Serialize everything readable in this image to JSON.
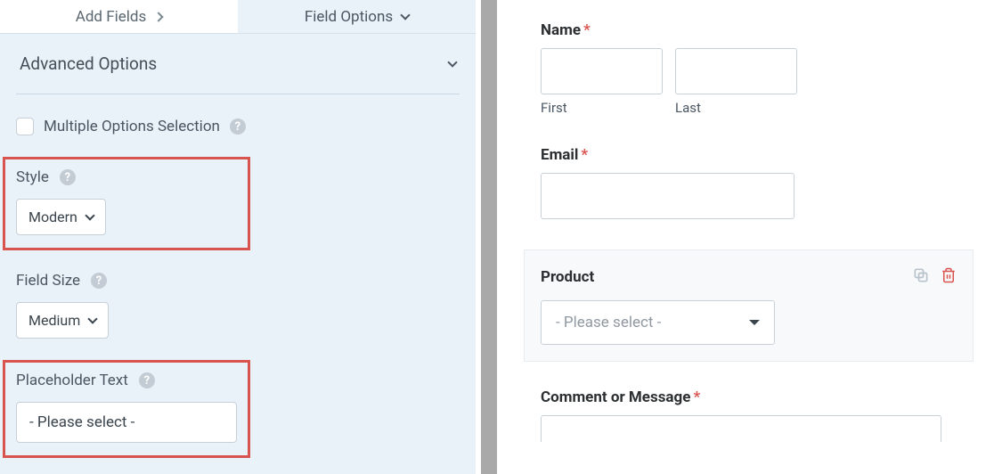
{
  "tabs": {
    "add_fields": "Add Fields",
    "field_options": "Field Options"
  },
  "advanced": {
    "title": "Advanced Options",
    "multiple_options": "Multiple Options Selection",
    "style": {
      "label": "Style",
      "value": "Modern"
    },
    "field_size": {
      "label": "Field Size",
      "value": "Medium"
    },
    "placeholder": {
      "label": "Placeholder Text",
      "value": "- Please select -"
    }
  },
  "preview": {
    "name": {
      "label": "Name",
      "first": "First",
      "last": "Last"
    },
    "email": {
      "label": "Email"
    },
    "product": {
      "label": "Product",
      "placeholder": "- Please select -"
    },
    "comment": {
      "label": "Comment or Message"
    },
    "required_marker": "*"
  }
}
